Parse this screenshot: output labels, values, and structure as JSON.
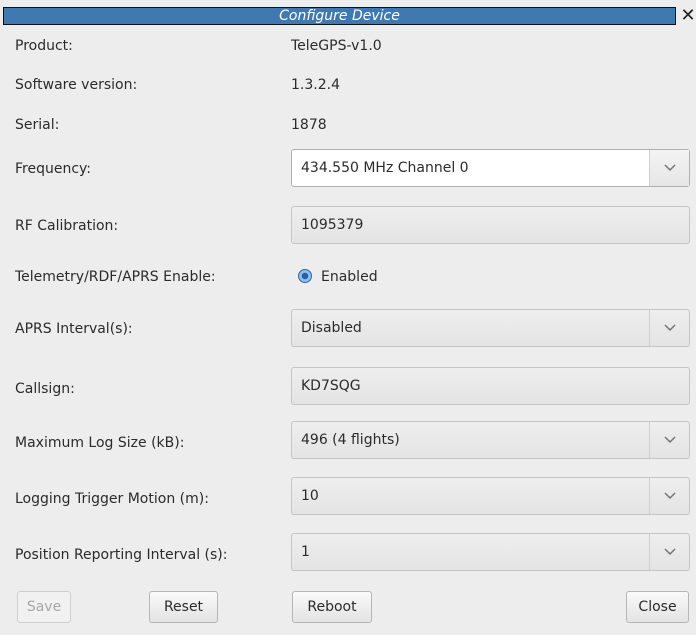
{
  "window": {
    "title": "Configure Device",
    "close_glyph": "✕"
  },
  "info": {
    "product_label": "Product:",
    "product_value": "TeleGPS-v1.0",
    "software_label": "Software version:",
    "software_value": "1.3.2.4",
    "serial_label": "Serial:",
    "serial_value": "1878"
  },
  "form": {
    "frequency_label": "Frequency:",
    "frequency_value": "434.550 MHz Channel 0",
    "rf_label": "RF Calibration:",
    "rf_value": "1095379",
    "telemetry_label": "Telemetry/RDF/APRS Enable:",
    "telemetry_value": "Enabled",
    "aprs_label": "APRS Interval(s):",
    "aprs_value": "Disabled",
    "callsign_label": "Callsign:",
    "callsign_value": "KD7SQG",
    "logsize_label": "Maximum Log Size (kB):",
    "logsize_value": "496 (4 flights)",
    "trigger_label": "Logging Trigger Motion (m):",
    "trigger_value": "10",
    "position_label": "Position Reporting Interval (s):",
    "position_value": "1"
  },
  "buttons": {
    "save": "Save",
    "reset": "Reset",
    "reboot": "Reboot",
    "close": "Close"
  },
  "icons": {
    "dropdown": "chevron-down-icon",
    "close": "close-icon"
  },
  "colors": {
    "title_bar": "#3f79b0",
    "radio_selected": "#2a5ea8"
  }
}
